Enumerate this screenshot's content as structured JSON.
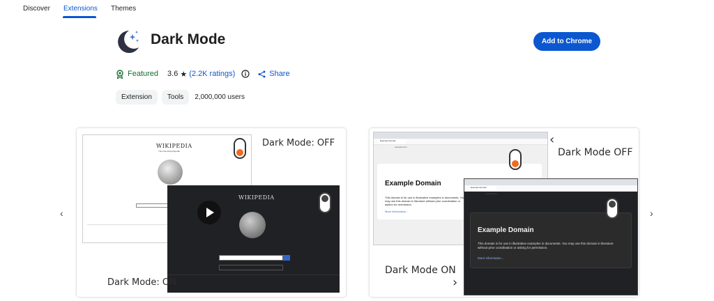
{
  "nav": {
    "discover": "Discover",
    "extensions": "Extensions",
    "themes": "Themes"
  },
  "extension": {
    "title": "Dark Mode",
    "add_button": "Add to Chrome",
    "featured": "Featured",
    "rating": "3.6",
    "ratings_link": "(2.2K ratings)",
    "share": "Share",
    "chips": [
      "Extension",
      "Tools"
    ],
    "users": "2,000,000 users"
  },
  "carousel": {
    "prev_arrow": "‹",
    "next_arrow": "›",
    "slide1": {
      "off_label": "Dark Mode: OFF",
      "on_label": "Dark Mode: ON",
      "wiki_brand": "WIKIPEDIA",
      "wiki_tagline": "The Free Encyclopedia"
    },
    "slide2": {
      "off_label": "Dark Mode OFF",
      "on_label": "Dark Mode ON",
      "tab_title": "Example Domain",
      "url": "example.com",
      "light_title": "Example Domain",
      "light_text": "This domain is for use in illustrative examples in documents. You may use this domain in literature without prior coordination or asking for permission.",
      "light_link": "More information...",
      "dark_title": "Example Domain",
      "dark_text": "This domain is for use in illustrative examples in documents. You may use this domain in literature without prior coordination or asking for permission.",
      "dark_link": "More information..."
    }
  },
  "colors": {
    "accent": "#0b57d0",
    "featured": "#146c2e",
    "toggle_orange": "#f26a21"
  }
}
